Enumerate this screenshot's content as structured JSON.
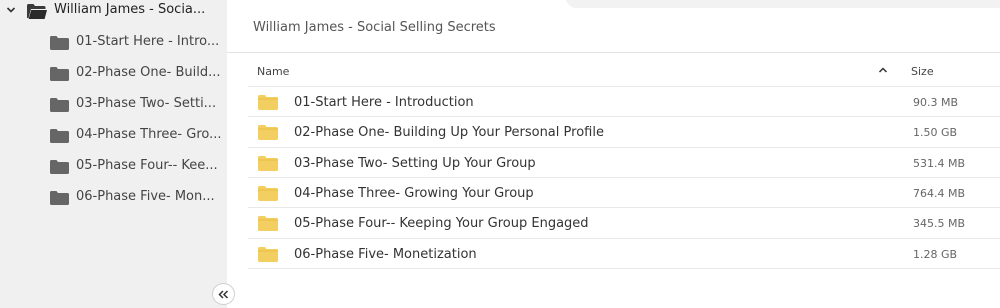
{
  "sidebar": {
    "root": {
      "label": "William James - Socia...",
      "icon": "folder-open-icon"
    },
    "items": [
      {
        "label": "01-Start Here - Intro..."
      },
      {
        "label": "02-Phase One- Build..."
      },
      {
        "label": "03-Phase Two- Setti..."
      },
      {
        "label": "04-Phase Three- Gro..."
      },
      {
        "label": "05-Phase Four-- Kee..."
      },
      {
        "label": "06-Phase Five- Mon..."
      }
    ],
    "collapse_icon": "double-chevron-left-icon"
  },
  "breadcrumb": {
    "title": "William James - Social Selling Secrets"
  },
  "table": {
    "columns": {
      "name": "Name",
      "size": "Size"
    },
    "sort_icon": "chevron-up-icon",
    "rows": [
      {
        "name": "01-Start Here - Introduction",
        "size": "90.3 MB"
      },
      {
        "name": "02-Phase One- Building Up Your Personal Profile",
        "size": "1.50 GB"
      },
      {
        "name": "03-Phase Two- Setting Up Your Group",
        "size": "531.4 MB"
      },
      {
        "name": "04-Phase Three- Growing Your Group",
        "size": "764.4 MB"
      },
      {
        "name": "05-Phase Four-- Keeping Your Group Engaged",
        "size": "345.5 MB"
      },
      {
        "name": "06-Phase Five- Monetization",
        "size": "1.28 GB"
      }
    ]
  },
  "colors": {
    "sidebar_bg": "#f0f0f0",
    "folder_yellow": "#f3cf61",
    "folder_dark": "#3a3a3a",
    "folder_grey": "#666666"
  }
}
